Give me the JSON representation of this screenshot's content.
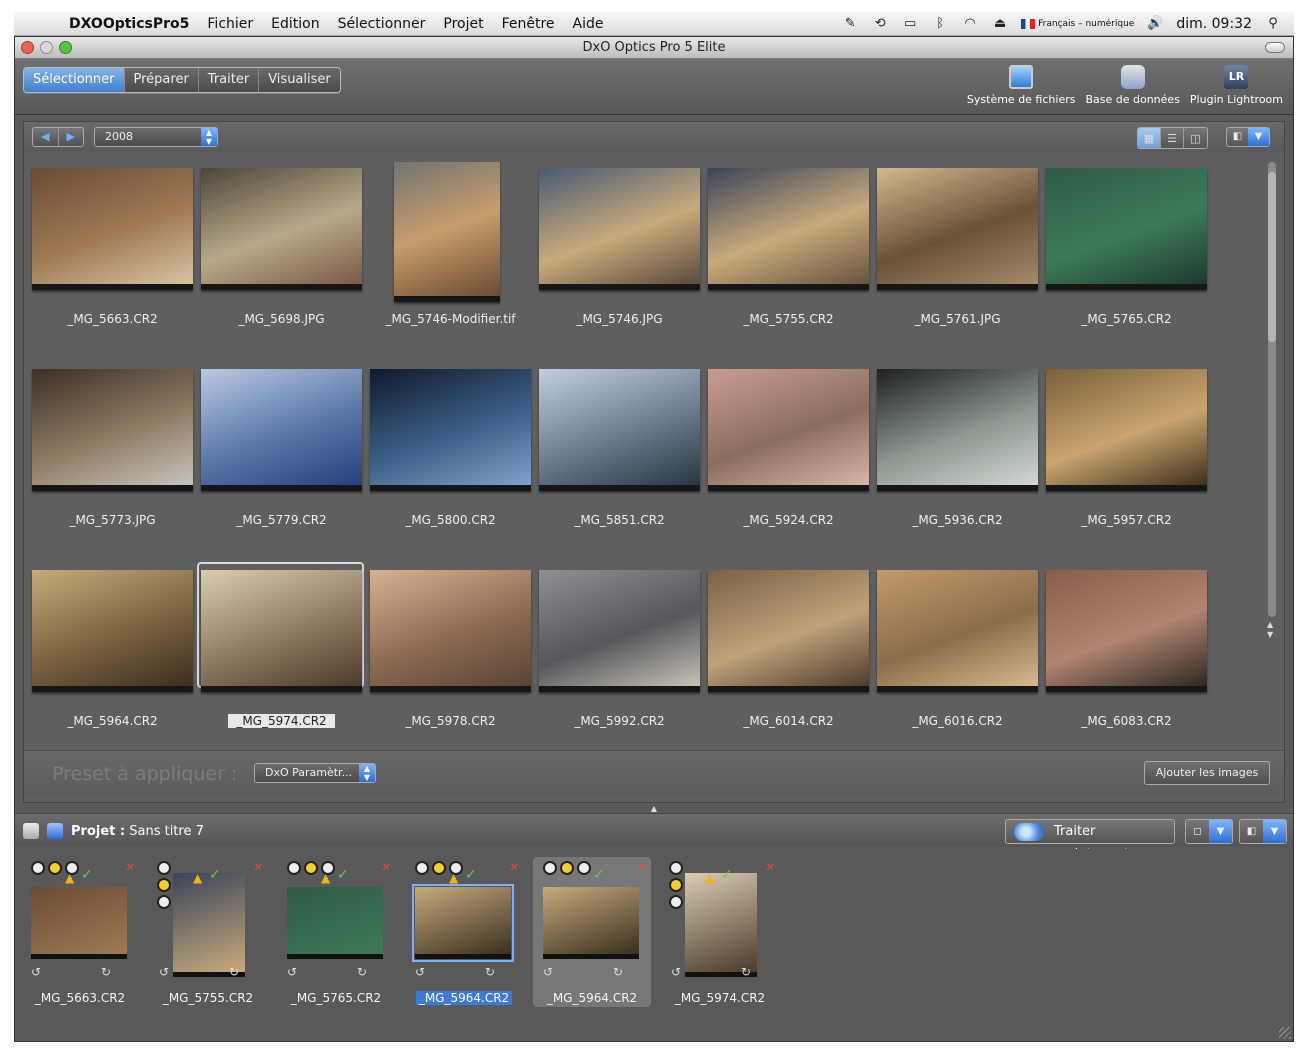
{
  "menubar": {
    "app_name": "DXOOpticsPro5",
    "items": [
      "Fichier",
      "Edition",
      "Sélectionner",
      "Projet",
      "Fenêtre",
      "Aide"
    ],
    "input_source": "Français – numérique",
    "clock": "dim. 09:32"
  },
  "window": {
    "title": "DxO Optics Pro 5 Elite"
  },
  "toolbar": {
    "tabs": [
      "Sélectionner",
      "Préparer",
      "Traiter",
      "Visualiser"
    ],
    "active_tab": "Sélectionner",
    "tools": [
      {
        "label": "Système de fichiers",
        "icon": "computer-icon"
      },
      {
        "label": "Base de données",
        "icon": "database-icon"
      },
      {
        "label": "Plugin Lightroom",
        "icon": "lightroom-icon",
        "icon_text": "LR"
      }
    ]
  },
  "browser": {
    "folder": "2008",
    "thumbnails": [
      {
        "name": "_MG_5663.CR2",
        "colors": [
          "#6b4b32",
          "#a07a56",
          "#d9c3a2"
        ],
        "portrait": false
      },
      {
        "name": "_MG_5698.JPG",
        "colors": [
          "#4d4638",
          "#b8a98a",
          "#7a5a45"
        ],
        "portrait": false
      },
      {
        "name": "_MG_5746-Modifier.tif",
        "colors": [
          "#5d6b74",
          "#c79d6c",
          "#6d4b33"
        ],
        "portrait": true
      },
      {
        "name": "_MG_5746.JPG",
        "colors": [
          "#475b73",
          "#c8aa7c",
          "#5b4a3c"
        ],
        "portrait": false
      },
      {
        "name": "_MG_5755.CR2",
        "colors": [
          "#3a4559",
          "#c8aa7c",
          "#67543f"
        ],
        "portrait": false
      },
      {
        "name": "_MG_5761.JPG",
        "colors": [
          "#d3b98d",
          "#6a5238",
          "#a4896a"
        ],
        "portrait": false
      },
      {
        "name": "_MG_5765.CR2",
        "colors": [
          "#2f5a45",
          "#3d7a58",
          "#1d3a2d"
        ],
        "portrait": false
      },
      {
        "name": "_MG_5773.JPG",
        "colors": [
          "#3b3024",
          "#8f7a63",
          "#c5c4be"
        ],
        "portrait": false
      },
      {
        "name": "_MG_5779.CR2",
        "colors": [
          "#b9c9e3",
          "#5a77a8",
          "#26407a"
        ],
        "portrait": false
      },
      {
        "name": "_MG_5800.CR2",
        "colors": [
          "#0f1a2a",
          "#3c5f87",
          "#7fa2c8"
        ],
        "portrait": false
      },
      {
        "name": "_MG_5851.CR2",
        "colors": [
          "#c2cfe0",
          "#6b7c8e",
          "#2a3643"
        ],
        "portrait": false
      },
      {
        "name": "_MG_5924.CR2",
        "colors": [
          "#c99d93",
          "#8b6d5f",
          "#d8b5aa"
        ],
        "portrait": false
      },
      {
        "name": "_MG_5936.CR2",
        "colors": [
          "#1e2020",
          "#8b9790",
          "#d3d8d4"
        ],
        "portrait": false
      },
      {
        "name": "_MG_5957.CR2",
        "colors": [
          "#7a5f3b",
          "#c9a56f",
          "#3e2f1d"
        ],
        "portrait": false
      },
      {
        "name": "_MG_5964.CR2",
        "colors": [
          "#c5ab7d",
          "#7b6340",
          "#3c2e1f"
        ],
        "portrait": false
      },
      {
        "name": "_MG_5974.CR2",
        "colors": [
          "#d9cdb4",
          "#8e7a61",
          "#4b3b2a"
        ],
        "portrait": false,
        "selected": true
      },
      {
        "name": "_MG_5978.CR2",
        "colors": [
          "#d7b394",
          "#8d6a52",
          "#5a4436"
        ],
        "portrait": false
      },
      {
        "name": "_MG_5992.CR2",
        "colors": [
          "#8f8f95",
          "#56565c",
          "#c7c2b5"
        ],
        "portrait": false
      },
      {
        "name": "_MG_6014.CR2",
        "colors": [
          "#7a6146",
          "#c0a27a",
          "#4e3c2a"
        ],
        "portrait": false
      },
      {
        "name": "_MG_6016.CR2",
        "colors": [
          "#c19a6e",
          "#8c6d4b",
          "#d8b88d"
        ],
        "portrait": false
      },
      {
        "name": "_MG_6083.CR2",
        "colors": [
          "#8b5c4b",
          "#b08470",
          "#2e2824"
        ],
        "portrait": false
      }
    ],
    "preset_label": "Preset à appliquer :",
    "preset_value": "DxO Paramètr...",
    "add_images_label": "Ajouter les images"
  },
  "project": {
    "label": "Projet :",
    "name": "Sans titre 7",
    "process_label": "Traiter maintenant",
    "items": [
      {
        "name": "_MG_5663.CR2",
        "colors": [
          "#6b4b32",
          "#a07a56"
        ],
        "portrait": false,
        "dots": [
          false,
          true,
          false
        ],
        "vertical_dots": false,
        "warn": true,
        "check": true
      },
      {
        "name": "_MG_5755.CR2",
        "colors": [
          "#3a4559",
          "#c8aa7c"
        ],
        "portrait": true,
        "dots": [
          false,
          true,
          false
        ],
        "vertical_dots": true,
        "warn": true,
        "check": true
      },
      {
        "name": "_MG_5765.CR2",
        "colors": [
          "#2f5a45",
          "#3d7a58"
        ],
        "portrait": false,
        "dots": [
          false,
          true,
          false
        ],
        "vertical_dots": false,
        "warn": true,
        "check": true
      },
      {
        "name": "_MG_5964.CR2",
        "colors": [
          "#c5ab7d",
          "#3c2e1f"
        ],
        "portrait": false,
        "dots": [
          false,
          true,
          false
        ],
        "vertical_dots": false,
        "warn": true,
        "check": true,
        "current": true,
        "label_selected": true
      },
      {
        "name": "_MG_5964.CR2",
        "colors": [
          "#c5ab7d",
          "#3c2e1f"
        ],
        "portrait": false,
        "dots": [
          false,
          true,
          false
        ],
        "vertical_dots": false,
        "warn": false,
        "check": true,
        "active": true
      },
      {
        "name": "_MG_5974.CR2",
        "colors": [
          "#d9cdb4",
          "#4b3b2a"
        ],
        "portrait": true,
        "dots": [
          false,
          true,
          false
        ],
        "vertical_dots": true,
        "warn": true,
        "check": true
      }
    ]
  }
}
